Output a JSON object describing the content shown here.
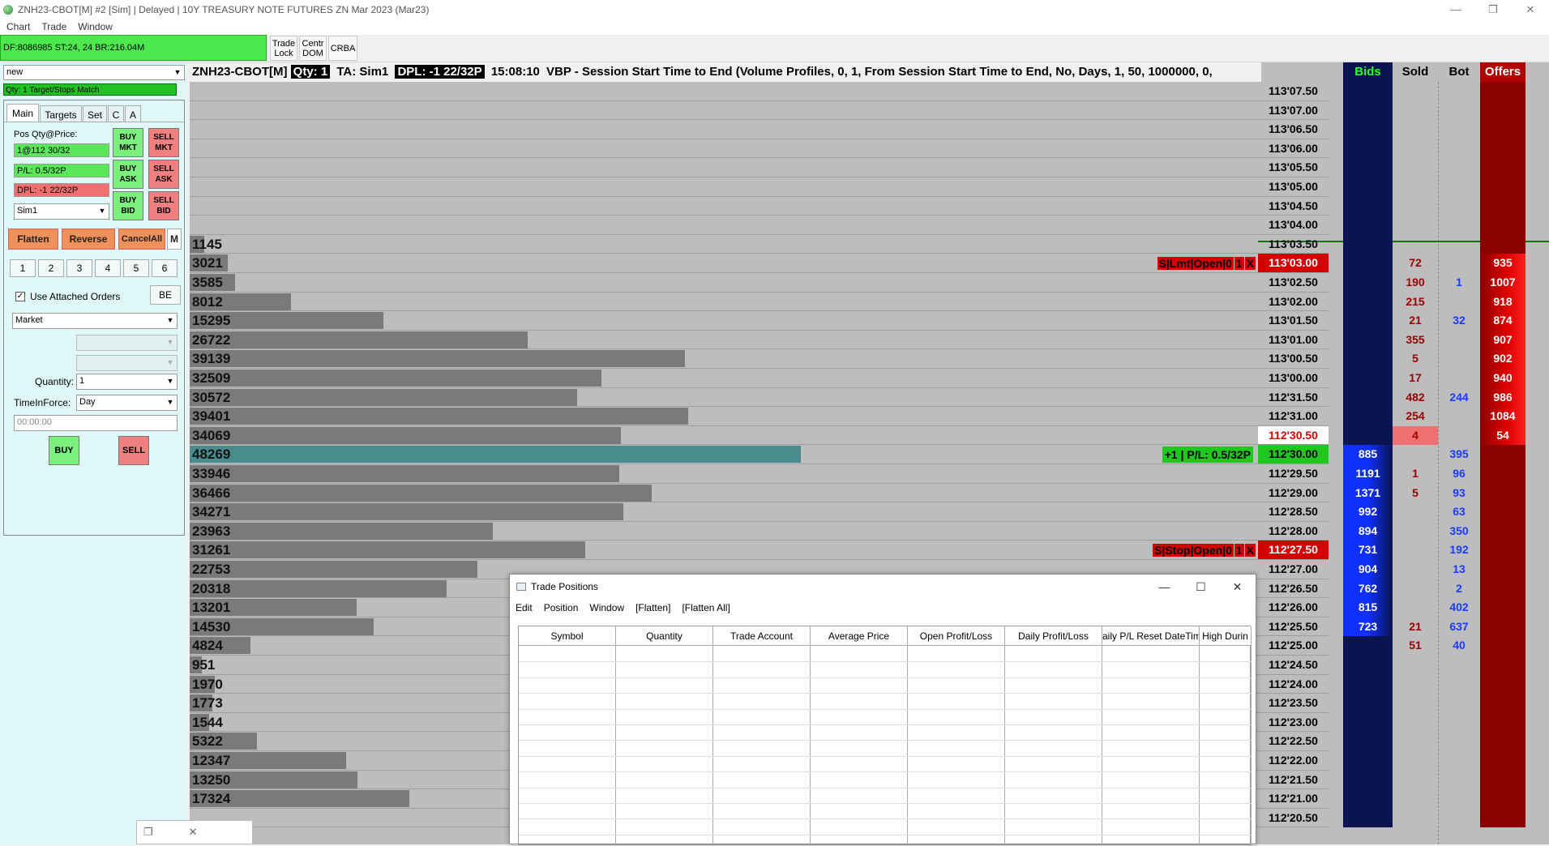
{
  "window": {
    "title": "ZNH23-CBOT[M]  #2 [Sim]  | Delayed | 10Y TREASURY NOTE FUTURES ZN Mar 2023 (Mar23)",
    "minimize": "—",
    "restore": "❐",
    "close": "✕"
  },
  "menu": [
    "Chart",
    "Trade",
    "Window"
  ],
  "toolbar": {
    "status": "DF:8086985  ST:24, 24  BR:216.04M",
    "btn1": [
      "Trade",
      "Lock"
    ],
    "btn2": [
      "Centr",
      "DOM"
    ],
    "btn3": "CRBA"
  },
  "left": {
    "account_select": "new",
    "target_match": "Qty: 1 Target/Stops Match",
    "tabs": [
      "Main",
      "Targets",
      "Set",
      "C",
      "A"
    ],
    "pos_label": "Pos Qty@Price:",
    "pos_value": "1@112 30/32",
    "pl_value": "P/L: 0.5/32P",
    "dpl_value": "DPL: -1 22/32P",
    "sim_account": "Sim1",
    "buy_mkt": [
      "BUY",
      "MKT"
    ],
    "sell_mkt": [
      "SELL",
      "MKT"
    ],
    "buy_ask": [
      "BUY",
      "ASK"
    ],
    "sell_ask": [
      "SELL",
      "ASK"
    ],
    "buy_bid": [
      "BUY",
      "BID"
    ],
    "sell_bid": [
      "SELL",
      "BID"
    ],
    "flatten": "Flatten",
    "reverse": "Reverse",
    "cancel_all": "CancelAll",
    "m": "M",
    "numbers": [
      "1",
      "2",
      "3",
      "4",
      "5",
      "6"
    ],
    "use_attached": "Use Attached Orders",
    "be": "BE",
    "order_type": "Market",
    "quantity_label": "Quantity:",
    "quantity": "1",
    "tif_label": "TimeInForce:",
    "tif": "Day",
    "time": "00:00:00",
    "buy": "BUY",
    "sell": "SELL"
  },
  "chart": {
    "symbol": "ZNH23-CBOT[M]",
    "qty": "Qty: 1",
    "ta": "TA: Sim1",
    "dpl": "DPL: -1 22/32P",
    "time": "15:08:10",
    "study": "VBP - Session Start Time to End   (Volume Profiles, 0, 1, From Session Start Time to End, No, Days, 1, 50, 1000000, 0,",
    "dom_headers": {
      "bids": "Bids",
      "sold": "Sold",
      "bot": "Bot",
      "offers": "Offers"
    },
    "rows": [
      {
        "price": "113'07.50",
        "vol": "",
        "w": 0
      },
      {
        "price": "113'07.00",
        "vol": "",
        "w": 0
      },
      {
        "price": "113'06.50",
        "vol": "",
        "w": 0
      },
      {
        "price": "113'06.00",
        "vol": "",
        "w": 0
      },
      {
        "price": "113'05.50",
        "vol": "",
        "w": 0
      },
      {
        "price": "113'05.00",
        "vol": "",
        "w": 0
      },
      {
        "price": "113'04.50",
        "vol": "",
        "w": 0
      },
      {
        "price": "113'04.00",
        "vol": "",
        "w": 0
      },
      {
        "price": "113'03.50",
        "vol": "1145",
        "w": 1145
      },
      {
        "price": "113'03.00",
        "vol": "3021",
        "w": 3021,
        "sold": "72",
        "offer": "935",
        "pstyle": "red"
      },
      {
        "price": "113'02.50",
        "vol": "3585",
        "w": 3585,
        "sold": "190",
        "bot": "1",
        "offer": "1007"
      },
      {
        "price": "113'02.00",
        "vol": "8012",
        "w": 8012,
        "sold": "215",
        "offer": "918"
      },
      {
        "price": "113'01.50",
        "vol": "15295",
        "w": 15295,
        "sold": "21",
        "bot": "32",
        "offer": "874"
      },
      {
        "price": "113'01.00",
        "vol": "26722",
        "w": 26722,
        "sold": "355",
        "offer": "907"
      },
      {
        "price": "113'00.50",
        "vol": "39139",
        "w": 39139,
        "sold": "5",
        "offer": "902"
      },
      {
        "price": "113'00.00",
        "vol": "32509",
        "w": 32509,
        "sold": "17",
        "offer": "940"
      },
      {
        "price": "112'31.50",
        "vol": "30572",
        "w": 30572,
        "sold": "482",
        "bot": "244",
        "offer": "986"
      },
      {
        "price": "112'31.00",
        "vol": "39401",
        "w": 39401,
        "sold": "254",
        "offer": "1084"
      },
      {
        "price": "112'30.50",
        "vol": "34069",
        "w": 34069,
        "sold": "4",
        "offer": "54",
        "pstyle": "cur"
      },
      {
        "price": "112'30.00",
        "vol": "48269",
        "w": 48269,
        "bid": "885",
        "bot": "395",
        "pstyle": "grn",
        "poc": true
      },
      {
        "price": "112'29.50",
        "vol": "33946",
        "w": 33946,
        "bid": "1191",
        "sold": "1",
        "bot": "96"
      },
      {
        "price": "112'29.00",
        "vol": "36466",
        "w": 36466,
        "bid": "1371",
        "sold": "5",
        "bot": "93"
      },
      {
        "price": "112'28.50",
        "vol": "34271",
        "w": 34271,
        "bid": "992",
        "bot": "63"
      },
      {
        "price": "112'28.00",
        "vol": "23963",
        "w": 23963,
        "bid": "894",
        "bot": "350"
      },
      {
        "price": "112'27.50",
        "vol": "31261",
        "w": 31261,
        "bid": "731",
        "bot": "192",
        "pstyle": "red"
      },
      {
        "price": "112'27.00",
        "vol": "22753",
        "w": 22753,
        "bid": "904",
        "bot": "13"
      },
      {
        "price": "112'26.50",
        "vol": "20318",
        "w": 20318,
        "bid": "762",
        "bot": "2"
      },
      {
        "price": "112'26.00",
        "vol": "13201",
        "w": 13201,
        "bid": "815",
        "bot": "402"
      },
      {
        "price": "112'25.50",
        "vol": "14530",
        "w": 14530,
        "bid": "723",
        "sold": "21",
        "bot": "637"
      },
      {
        "price": "112'25.00",
        "vol": "4824",
        "w": 4824,
        "sold": "51",
        "bot": "40"
      },
      {
        "price": "112'24.50",
        "vol": "951",
        "w": 951
      },
      {
        "price": "112'24.00",
        "vol": "1970",
        "w": 1970
      },
      {
        "price": "112'23.50",
        "vol": "1773",
        "w": 1773
      },
      {
        "price": "112'23.00",
        "vol": "1544",
        "w": 1544
      },
      {
        "price": "112'22.50",
        "vol": "5322",
        "w": 5322
      },
      {
        "price": "112'22.00",
        "vol": "12347",
        "w": 12347
      },
      {
        "price": "112'21.50",
        "vol": "13250",
        "w": 13250
      },
      {
        "price": "112'21.00",
        "vol": "17324",
        "w": 17324
      },
      {
        "price": "112'20.50",
        "vol": "",
        "w": 0
      }
    ],
    "order_tags": {
      "lmt": [
        "S|Lmt|Open|0",
        "1",
        "X"
      ],
      "pos": "+1 | P/L: 0.5/32P",
      "stop": [
        "S|Stop|Open|0",
        "1",
        "X"
      ]
    }
  },
  "trade_positions": {
    "title": "Trade Positions",
    "menu": [
      "Edit",
      "Position",
      "Window",
      "[Flatten]",
      "[Flatten All]"
    ],
    "columns": [
      "Symbol",
      "Quantity",
      "Trade Account",
      "Average Price",
      "Open Profit/Loss",
      "Daily Profit/Loss",
      "aily P/L Reset DateTim",
      "High Durin"
    ]
  }
}
